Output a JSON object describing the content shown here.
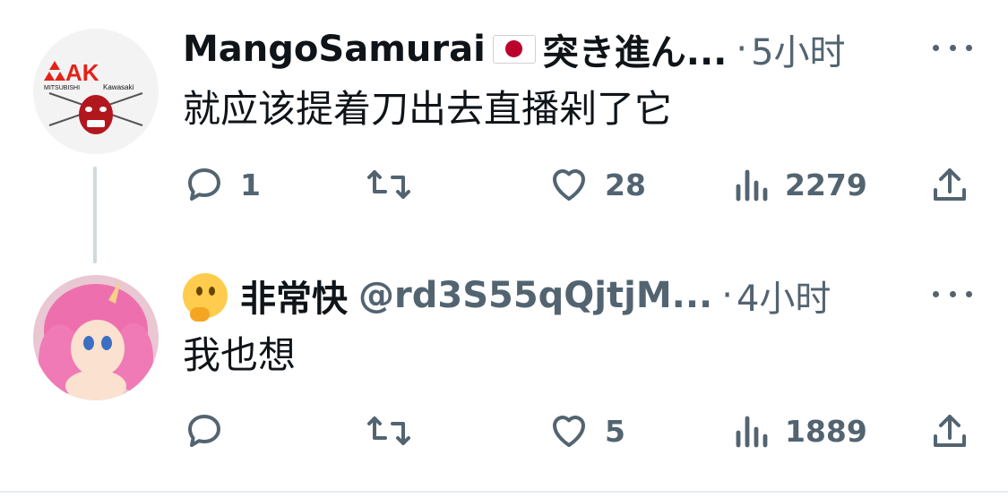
{
  "tweets": [
    {
      "name": "MangoSamurai",
      "name_suffix": "突き進ん...",
      "time": "5小时",
      "text": "就应该提着刀出去直播剁了它",
      "avatar_label_top": "MITSUBISHI",
      "avatar_label_side": "Kawasaki",
      "avatar_logo": "AK",
      "replies": "1",
      "retweets": "",
      "likes": "28",
      "views": "2279"
    },
    {
      "name": "非常快",
      "handle": "@rd3S55qQjtjM...",
      "time": "4小时",
      "text": "我也想",
      "replies": "",
      "retweets": "",
      "likes": "5",
      "views": "1889"
    }
  ],
  "icons": {
    "reply": "reply-icon",
    "retweet": "retweet-icon",
    "like": "heart-icon",
    "views": "views-icon",
    "share": "share-icon",
    "more": "more-icon"
  },
  "colors": {
    "secondary": "#536471",
    "thread_line": "#cfd9de",
    "text": "#0f1419"
  }
}
